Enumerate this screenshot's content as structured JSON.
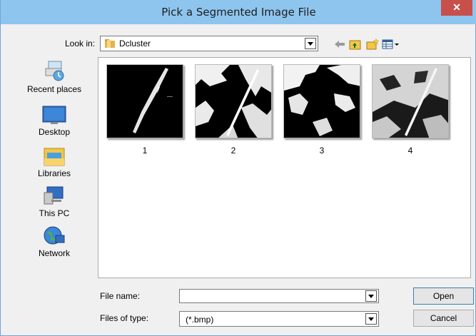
{
  "window": {
    "title": "Pick a Segmented Image File",
    "close_glyph": "✕"
  },
  "toolbar": {
    "look_in_label": "Look in:",
    "look_in_value": "Dcluster",
    "icons": [
      "back-arrow-icon",
      "up-folder-icon",
      "new-folder-icon",
      "view-menu-icon"
    ]
  },
  "places": [
    {
      "label": "Recent places",
      "icon": "recent-places-icon"
    },
    {
      "label": "Desktop",
      "icon": "desktop-icon"
    },
    {
      "label": "Libraries",
      "icon": "libraries-icon"
    },
    {
      "label": "This PC",
      "icon": "this-pc-icon"
    },
    {
      "label": "Network",
      "icon": "network-icon"
    }
  ],
  "files": [
    {
      "label": "1"
    },
    {
      "label": "2"
    },
    {
      "label": "3"
    },
    {
      "label": "4"
    }
  ],
  "form": {
    "file_name_label": "File name:",
    "file_name_value": "",
    "files_of_type_label": "Files of type:",
    "files_of_type_value": "(*.bmp)"
  },
  "buttons": {
    "open": "Open",
    "cancel": "Cancel"
  },
  "colors": {
    "titlebar": "#8ec5ee",
    "close": "#c7504b"
  }
}
